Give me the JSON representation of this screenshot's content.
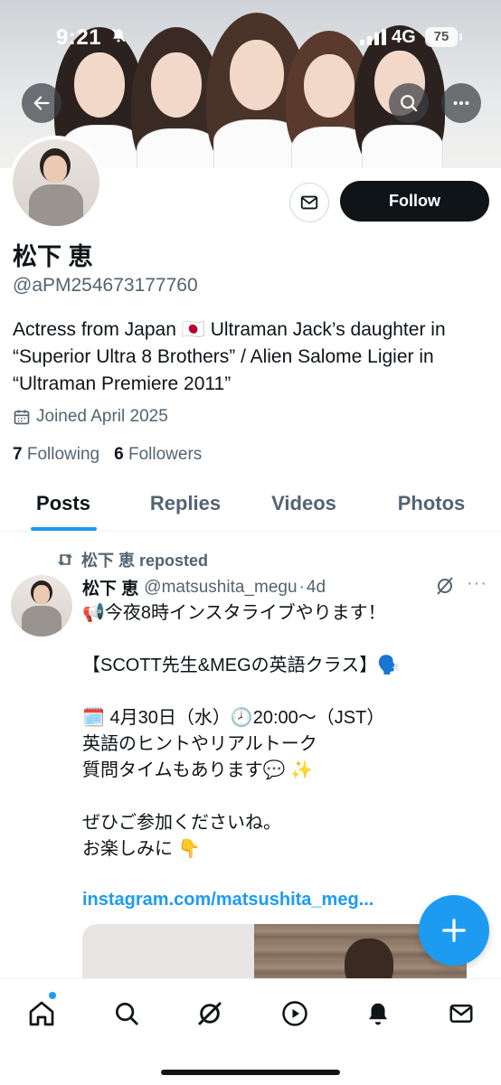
{
  "status_bar": {
    "time": "9:21",
    "network": "4G",
    "battery": "75"
  },
  "profile": {
    "display_name": "松下 恵",
    "handle": "@aPM254673177760",
    "bio": "Actress from Japan 🇯🇵 Ultraman Jack’s daughter in “Superior Ultra 8 Brothers” / Alien Salome Ligier in “Ultraman Premiere 2011”",
    "joined": "Joined April 2025",
    "following_count": "7",
    "following_label": "Following",
    "followers_count": "6",
    "followers_label": "Followers",
    "follow_button": "Follow"
  },
  "tabs": [
    {
      "label": "Posts",
      "active": true
    },
    {
      "label": "Replies",
      "active": false
    },
    {
      "label": "Videos",
      "active": false
    },
    {
      "label": "Photos",
      "active": false
    }
  ],
  "post": {
    "repost_label": "松下 恵 reposted",
    "author_name": "松下 恵",
    "author_handle": "@matsushita_megu",
    "separator": "·",
    "time_ago": "4d",
    "lines": [
      "📢今夜8時インスタライブやります！",
      "",
      "【SCOTT先生&MEGの英語クラス】🗣️",
      "",
      "🗓️ 4月30日（水）🕗20:00〜（JST）",
      "英語のヒントやリアルトーク",
      "質問タイムもあります💬 ✨",
      "",
      "ぜひご参加くださいね。",
      "お楽しみに 👇"
    ],
    "link": "instagram.com/matsushita_meg..."
  },
  "icons": {
    "back": "arrow-left-icon",
    "search": "search-icon",
    "more": "more-horizontal-icon",
    "message": "mail-icon",
    "calendar": "calendar-icon",
    "repost": "repost-icon",
    "grok": "grok-icon",
    "compose": "plus-icon",
    "nav": [
      "home-icon",
      "search-icon",
      "grok-icon",
      "play-icon",
      "bell-icon",
      "mail-icon"
    ]
  },
  "colors": {
    "accent": "#1d9bf0",
    "text": "#0f1419",
    "secondary": "#536471"
  }
}
